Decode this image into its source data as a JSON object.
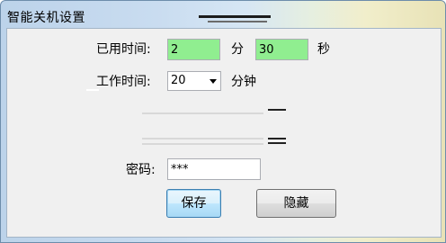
{
  "window": {
    "title": "智能关机设置"
  },
  "used_time": {
    "label": "已用时间:",
    "minutes_value": "2",
    "minutes_unit": "分",
    "seconds_value": "30",
    "seconds_unit": "秒"
  },
  "work_time": {
    "label": "工作时间:",
    "selected": "20",
    "unit": "分钟"
  },
  "password": {
    "label": "密码:",
    "value": "***"
  },
  "buttons": {
    "save": "保存",
    "hide": "隐藏"
  },
  "colors": {
    "active_field": "#90ee90",
    "client_background": "#f0f0f0"
  }
}
